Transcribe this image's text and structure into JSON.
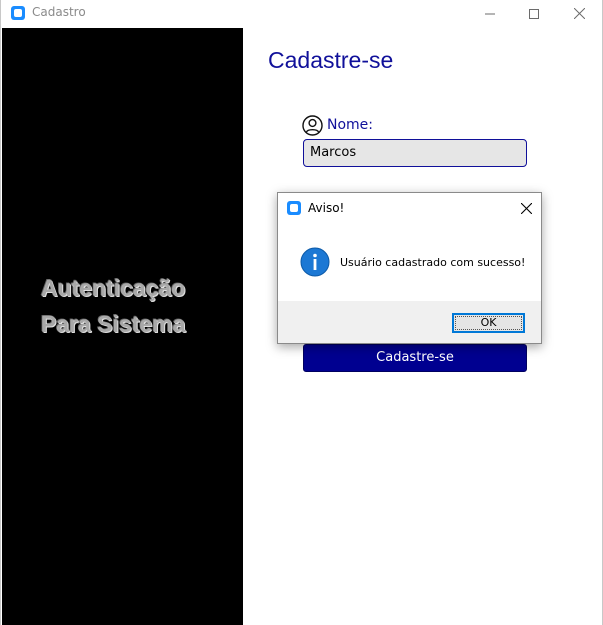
{
  "window": {
    "title": "Cadastro",
    "app_icon": "app-icon",
    "controls": {
      "minimize_icon": "minimize-icon",
      "maximize_icon": "maximize-icon",
      "close_icon": "close-icon"
    }
  },
  "left_panel": {
    "line1": "Autenticação",
    "line2": "Para Sistema",
    "background": "#000000"
  },
  "form": {
    "title": "Cadastre-se",
    "name_label": "Nome:",
    "name_icon": "user-circle-icon",
    "name_value": "Marcos",
    "submit_label": "Cadastre-se",
    "accent": "#10109a",
    "button_color": "#000090"
  },
  "dialog": {
    "title": "Aviso!",
    "message": "Usuário cadastrado com sucesso!",
    "icon": "info-icon",
    "ok_label": "OK"
  }
}
